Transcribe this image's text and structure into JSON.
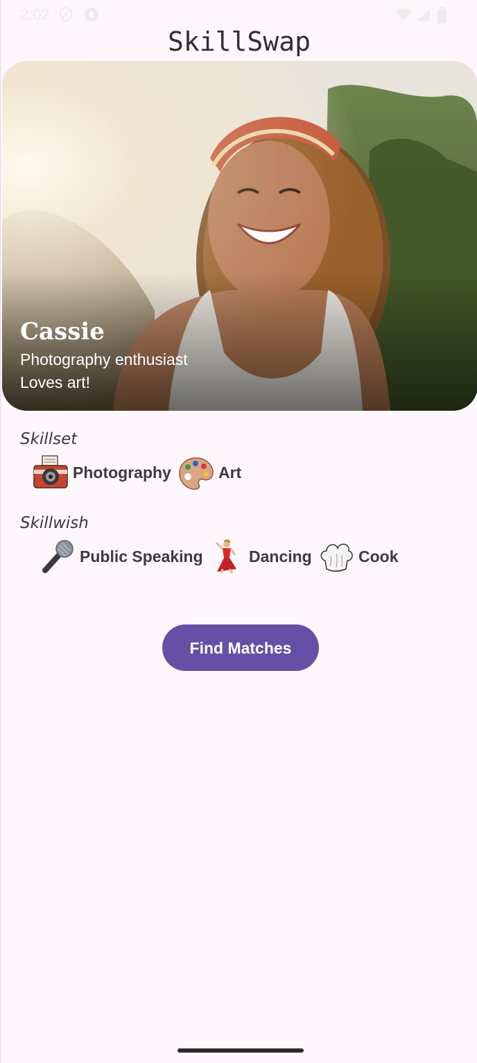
{
  "status_bar": {
    "time": "2:02",
    "icons": [
      "shield-icon",
      "vpn-icon",
      "wifi-icon",
      "signal-icon",
      "battery-icon"
    ]
  },
  "app": {
    "title": "SkillSwap"
  },
  "profile": {
    "name": "Cassie",
    "bio_line1": "Photography enthusiast",
    "bio_line2": "Loves art!"
  },
  "skillset": {
    "label": "Skillset",
    "items": [
      {
        "label": "Photography",
        "icon": "camera-icon"
      },
      {
        "label": "Art",
        "icon": "palette-icon"
      }
    ]
  },
  "skillwish": {
    "label": "Skillwish",
    "items": [
      {
        "label": "Public Speaking",
        "icon": "microphone-icon"
      },
      {
        "label": "Dancing",
        "icon": "dancer-icon"
      },
      {
        "label": "Cook",
        "icon": "chef-hat-icon"
      }
    ]
  },
  "actions": {
    "find_matches": "Find Matches"
  },
  "colors": {
    "background": "#fdf7fc",
    "primary": "#6451a5",
    "text": "#3d3a40"
  }
}
